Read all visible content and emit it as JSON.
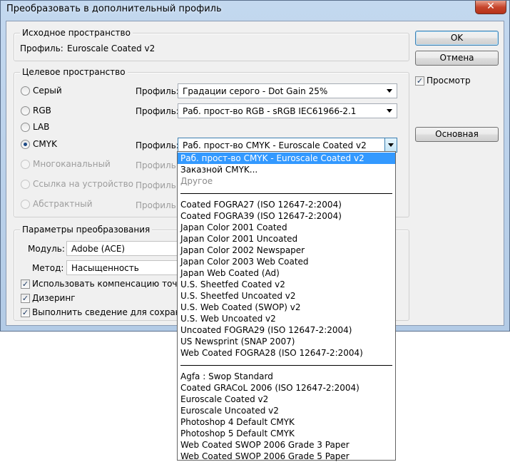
{
  "window": {
    "title": "Преобразовать в дополнительный профиль",
    "close_glyph": "✕"
  },
  "source": {
    "legend": "Исходное пространство",
    "profile_label": "Профиль:",
    "profile_value": "Euroscale Coated v2"
  },
  "target": {
    "legend": "Целевое пространство",
    "modes": {
      "gray": "Серый",
      "rgb": "RGB",
      "lab": "LAB",
      "cmyk": "CMYK",
      "multichannel": "Многоканальный",
      "device_link": "Ссылка на устройство",
      "abstract": "Абстрактный"
    },
    "profile_label": "Профиль:",
    "gray_profile": "Градации серого - Dot Gain 25%",
    "rgb_profile": "Раб. прост-во RGB - sRGB IEC61966-2.1",
    "cmyk_profile": "Раб. прост-во CMYK - Euroscale Coated v2"
  },
  "conversion": {
    "legend": "Параметры преобразования",
    "engine_label": "Модуль:",
    "engine_value": "Adobe (ACE)",
    "intent_label": "Метод:",
    "intent_value": "Насыщенность",
    "bpc_label": "Использовать компенсацию точки ч",
    "dither_label": "Дизеринг",
    "flatten_label": "Выполнить сведение для сохранен"
  },
  "buttons": {
    "ok": "OK",
    "cancel": "Отмена",
    "advanced": "Основная"
  },
  "preview": {
    "label": "Просмотр",
    "check_glyph": "✓"
  },
  "dropdown": {
    "groups": [
      [
        "Раб. прост-во CMYK - Euroscale Coated v2",
        "Заказной CMYK...",
        "Другое"
      ],
      [
        "Coated FOGRA27 (ISO 12647-2:2004)",
        "Coated FOGRA39 (ISO 12647-2:2004)",
        "Japan Color 2001 Coated",
        "Japan Color 2001 Uncoated",
        "Japan Color 2002 Newspaper",
        "Japan Color 2003 Web Coated",
        "Japan Web Coated (Ad)",
        "U.S. Sheetfed Coated v2",
        "U.S. Sheetfed Uncoated v2",
        "U.S. Web Coated (SWOP) v2",
        "U.S. Web Uncoated v2",
        "Uncoated FOGRA29 (ISO 12647-2:2004)",
        "US Newsprint (SNAP 2007)",
        "Web Coated FOGRA28 (ISO 12647-2:2004)"
      ],
      [
        "Agfa : Swop Standard",
        "Coated GRACoL 2006 (ISO 12647-2:2004)",
        "Euroscale Coated v2",
        "Euroscale Uncoated v2",
        "Photoshop 4 Default CMYK",
        "Photoshop 5 Default CMYK",
        "Web Coated SWOP 2006 Grade 3 Paper",
        "Web Coated SWOP 2006 Grade 5 Paper"
      ]
    ]
  },
  "colors": {
    "selection": "#3399ff",
    "window_frame": "#c3d8ef",
    "dialog_bg": "#f0f0f0"
  }
}
